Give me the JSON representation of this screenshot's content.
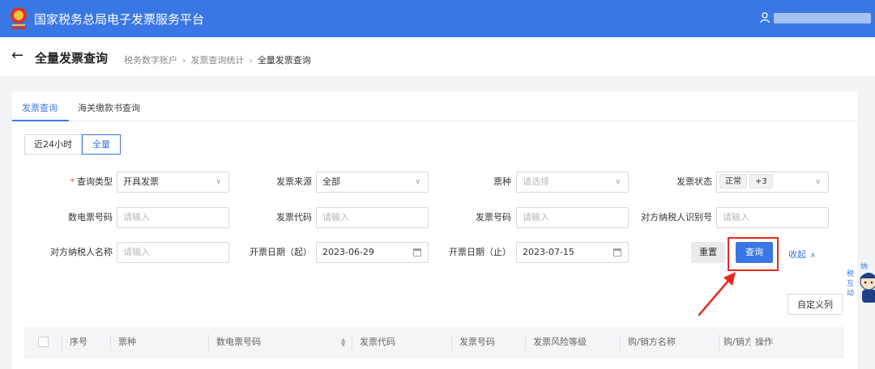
{
  "header": {
    "app_title": "国家税务总局电子发票服务平台",
    "brand_color": "#3a77e6"
  },
  "page": {
    "title": "全量发票查询",
    "breadcrumb": [
      "税务数字账户",
      "发票查询统计",
      "全量发票查询"
    ]
  },
  "tabs": [
    {
      "label": "发票查询",
      "active": true
    },
    {
      "label": "海关缴款书查询",
      "active": false
    }
  ],
  "range_buttons": [
    {
      "label": "近24小时",
      "active": false
    },
    {
      "label": "全量",
      "active": true
    }
  ],
  "form": {
    "query_type": {
      "label": "查询类型",
      "required": true,
      "value": "开具发票"
    },
    "invoice_source": {
      "label": "发票来源",
      "value": "全部"
    },
    "ticket_type": {
      "label": "票种",
      "placeholder": "请选择"
    },
    "invoice_status": {
      "label": "发票状态",
      "tags": [
        "正常",
        "+3"
      ]
    },
    "e_invoice_no": {
      "label": "数电票号码",
      "placeholder": "请输入"
    },
    "invoice_code": {
      "label": "发票代码",
      "placeholder": "请输入"
    },
    "invoice_no": {
      "label": "发票号码",
      "placeholder": "请输入"
    },
    "counterparty_tax_id": {
      "label": "对方纳税人识别号",
      "placeholder": "请输入"
    },
    "counterparty_name": {
      "label": "对方纳税人名称",
      "placeholder": "请输入"
    },
    "date_start": {
      "label": "开票日期（起）",
      "value": "2023-06-29"
    },
    "date_end": {
      "label": "开票日期（止）",
      "value": "2023-07-15"
    }
  },
  "actions": {
    "reset": "重置",
    "query": "查询",
    "collapse": "收起",
    "custom_columns": "自定义列"
  },
  "table": {
    "columns": [
      "序号",
      "票种",
      "数电票号码",
      "发票代码",
      "发票号码",
      "发票风险等级",
      "购/销方名称",
      "购/销方",
      "操作"
    ]
  },
  "helper": {
    "text": "纳税互动"
  }
}
